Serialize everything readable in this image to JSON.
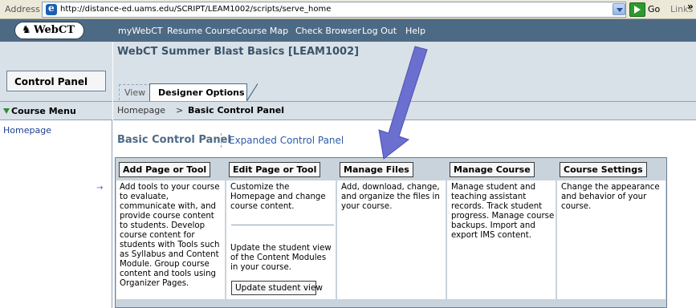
{
  "address_bar": {
    "label": "Address",
    "url": "http://distance-ed.uams.edu/SCRIPT/LEAM1002/scripts/serve_home",
    "go_label": "Go",
    "links_label": "Links",
    "chevron": "»"
  },
  "logo": {
    "text": "WebCT",
    "glyph": "♞"
  },
  "topnav": [
    "myWebCT",
    "Resume Course",
    "Course Map",
    "Check Browser",
    "Log Out",
    "Help"
  ],
  "sidebar": {
    "control_panel_label": "Control Panel",
    "course_menu_label": "Course Menu",
    "homepage_link": "Homepage",
    "arrow_tip": "→"
  },
  "header": {
    "course_title": "WebCT Summer Blast Basics [LEAM1002]",
    "tabs": [
      {
        "label": "View",
        "active": false
      },
      {
        "label": "Designer Options",
        "active": true
      }
    ]
  },
  "breadcrumb": {
    "home": "Homepage",
    "separator": ">",
    "current": "Basic Control Panel"
  },
  "panel": {
    "title": "Basic Control Panel",
    "alt_link": "Expanded Control Panel"
  },
  "columns": [
    {
      "button": "Add Page or Tool",
      "description": "Add tools to your course to evaluate, communicate with, and provide course content to students. Develop course content for students with Tools such as Syllabus and Content Module. Group course content and tools using Organizer Pages."
    },
    {
      "button": "Edit Page or Tool",
      "description": "Customize the Homepage and change course content.",
      "description2": "Update the student view of the Content Modules in your course.",
      "action_button": "Update student view"
    },
    {
      "button": "Manage Files",
      "description": "Add, download, change, and organize the files in your course."
    },
    {
      "button": "Manage Course",
      "description": "Manage student and teaching assistant records. Track student progress. Manage course backups. Import and export IMS content."
    },
    {
      "button": "Course Settings",
      "description": "Change the appearance and behavior of your course."
    }
  ],
  "colors": {
    "topbar": "#4d6a85",
    "panel_bg": "#d9e1e8",
    "table_bg": "#c9d3dc",
    "link": "#2f5ba7",
    "annotation_arrow": "#6a6fd0"
  }
}
